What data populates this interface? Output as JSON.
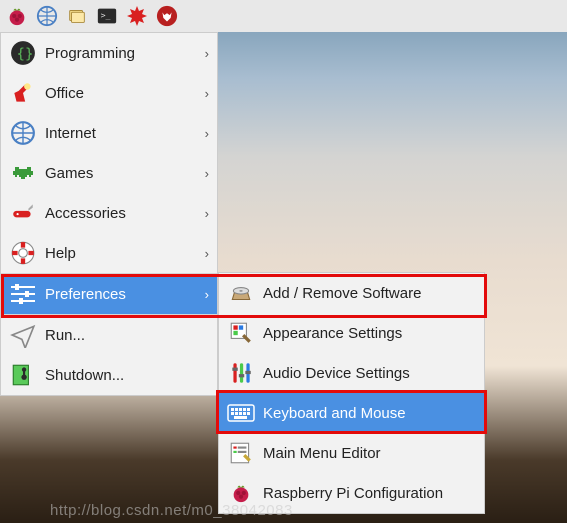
{
  "taskbar": {
    "icons": [
      "raspberry",
      "globe",
      "files",
      "terminal",
      "burst",
      "wolf"
    ]
  },
  "menu": {
    "items": [
      {
        "label": "Programming",
        "icon": "braces",
        "submenu": true
      },
      {
        "label": "Office",
        "icon": "lamp",
        "submenu": true
      },
      {
        "label": "Internet",
        "icon": "globe",
        "submenu": true
      },
      {
        "label": "Games",
        "icon": "invader",
        "submenu": true
      },
      {
        "label": "Accessories",
        "icon": "swissknife",
        "submenu": true
      },
      {
        "label": "Help",
        "icon": "lifebuoy",
        "submenu": true
      },
      {
        "label": "Preferences",
        "icon": "sliders",
        "submenu": true,
        "selected": true
      },
      {
        "label": "Run...",
        "icon": "paperplane",
        "submenu": false
      },
      {
        "label": "Shutdown...",
        "icon": "exit",
        "submenu": false
      }
    ]
  },
  "submenu": {
    "items": [
      {
        "label": "Add / Remove Software",
        "icon": "disc"
      },
      {
        "label": "Appearance Settings",
        "icon": "palette"
      },
      {
        "label": "Audio Device Settings",
        "icon": "audio-sliders"
      },
      {
        "label": "Keyboard and Mouse",
        "icon": "keyboard",
        "selected": true
      },
      {
        "label": "Main Menu Editor",
        "icon": "editor"
      },
      {
        "label": "Raspberry Pi Configuration",
        "icon": "raspberry"
      }
    ]
  },
  "watermark": "http://blog.csdn.net/m0_38042083"
}
